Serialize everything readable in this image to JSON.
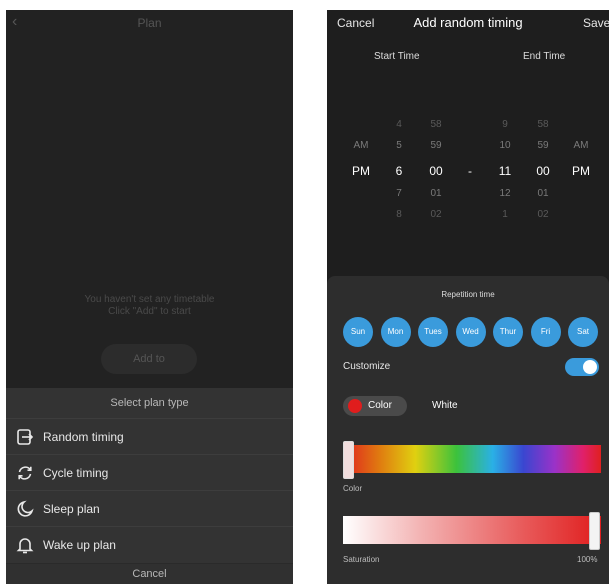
{
  "left": {
    "title": "Plan",
    "empty_line1": "You haven't set any timetable",
    "empty_line2": "Click \"Add\" to start",
    "add_label": "Add to",
    "sheet": {
      "title": "Select plan type",
      "items": [
        {
          "label": "Random timing",
          "icon": "random-timing-icon"
        },
        {
          "label": "Cycle timing",
          "icon": "cycle-icon"
        },
        {
          "label": "Sleep plan",
          "icon": "moon-icon"
        },
        {
          "label": "Wake up plan",
          "icon": "bell-icon"
        }
      ],
      "cancel": "Cancel"
    }
  },
  "right": {
    "header": {
      "cancel": "Cancel",
      "title": "Add random timing",
      "save": "Save"
    },
    "start_label": "Start Time",
    "end_label": "End Time",
    "start": {
      "ampm": [
        "AM",
        "PM"
      ],
      "hours": [
        "4",
        "5",
        "6",
        "7",
        "8"
      ],
      "minutes": [
        "58",
        "59",
        "00",
        "01",
        "02"
      ]
    },
    "separator": "-",
    "end": {
      "hours": [
        "9",
        "10",
        "11",
        "12",
        "1"
      ],
      "minutes": [
        "58",
        "59",
        "00",
        "01",
        "02"
      ],
      "ampm": [
        "AM",
        "PM"
      ]
    },
    "repetition_title": "Repetition time",
    "days": [
      "Sun",
      "Mon",
      "Tues",
      "Wed",
      "Thur",
      "Fri",
      "Sat"
    ],
    "customize_label": "Customize",
    "customize_on": true,
    "color_tab": "Color",
    "white_tab": "White",
    "color_label": "Color",
    "saturation_label": "Saturation",
    "saturation_value": "100%",
    "accent": "#3a9bdc",
    "selected_color": "#e01d1d"
  }
}
